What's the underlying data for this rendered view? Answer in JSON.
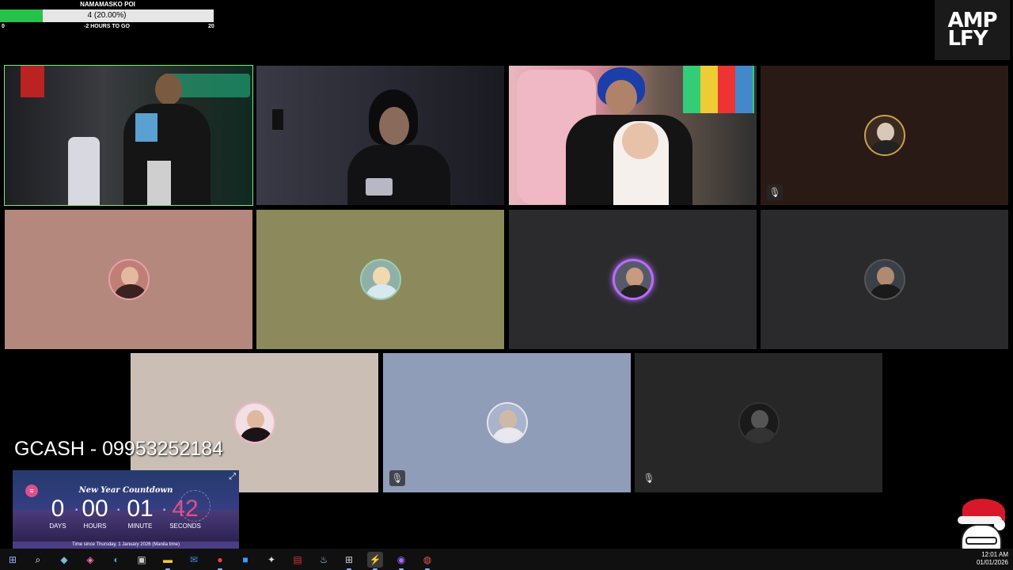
{
  "goal": {
    "title": "NAMAMASKO POI",
    "progress_text": "4 (20.00%)",
    "progress_fraction": 0.2,
    "min": "0",
    "max": "20",
    "subtitle": "-2 HOURS TO GO",
    "fill_color": "#27c24c"
  },
  "logo": {
    "text": "AMP\nLFY"
  },
  "tiles": [
    {
      "id": "tile-1",
      "type": "camera",
      "active": true,
      "bg": "#2b2b30"
    },
    {
      "id": "tile-2",
      "type": "camera",
      "bg": "#2a2a33"
    },
    {
      "id": "tile-3",
      "type": "camera",
      "bg": "#5b4b45"
    },
    {
      "id": "tile-4",
      "type": "avatar",
      "bg": "#2a1a16",
      "muted": true
    },
    {
      "id": "tile-5",
      "type": "avatar",
      "bg": "#b5887d"
    },
    {
      "id": "tile-6",
      "type": "avatar",
      "bg": "#8c8a5c"
    },
    {
      "id": "tile-7",
      "type": "avatar",
      "bg": "#2b2b2e",
      "ring": "purple"
    },
    {
      "id": "tile-8",
      "type": "avatar",
      "bg": "#2a2a2d"
    },
    {
      "id": "tile-9",
      "type": "avatar",
      "bg": "#cbbfb5"
    },
    {
      "id": "tile-10",
      "type": "avatar",
      "bg": "#909db8",
      "muted": true
    },
    {
      "id": "tile-11",
      "type": "avatar",
      "bg": "#272727",
      "muted": true
    }
  ],
  "gcash": {
    "text": "GCASH - 09953252184"
  },
  "countdown": {
    "title": "New Year Countdown",
    "days": "0",
    "hours": "00",
    "minutes": "01",
    "seconds": "42",
    "days_label": "DAYS",
    "hours_label": "HOURS",
    "minutes_label": "MINUTE",
    "seconds_label": "SECONDS",
    "footer": "Time since Thursday, 1 January 2026 (Manila time)",
    "seconds_color": "#e0508a"
  },
  "taskbar": {
    "icons": [
      "windows-start-icon",
      "search-icon",
      "copilot-icon",
      "winamp-icon",
      "edge-icon",
      "store-icon",
      "file-explorer-icon",
      "outlook-icon",
      "chrome-icon",
      "microsoft-store-icon",
      "bird-icon",
      "voicemeeter-icon",
      "steam-icon",
      "app-grid-icon",
      "amplfy-icon",
      "messenger-icon",
      "tool-icon"
    ],
    "time": "12:01 AM",
    "date": "01/01/2026"
  }
}
